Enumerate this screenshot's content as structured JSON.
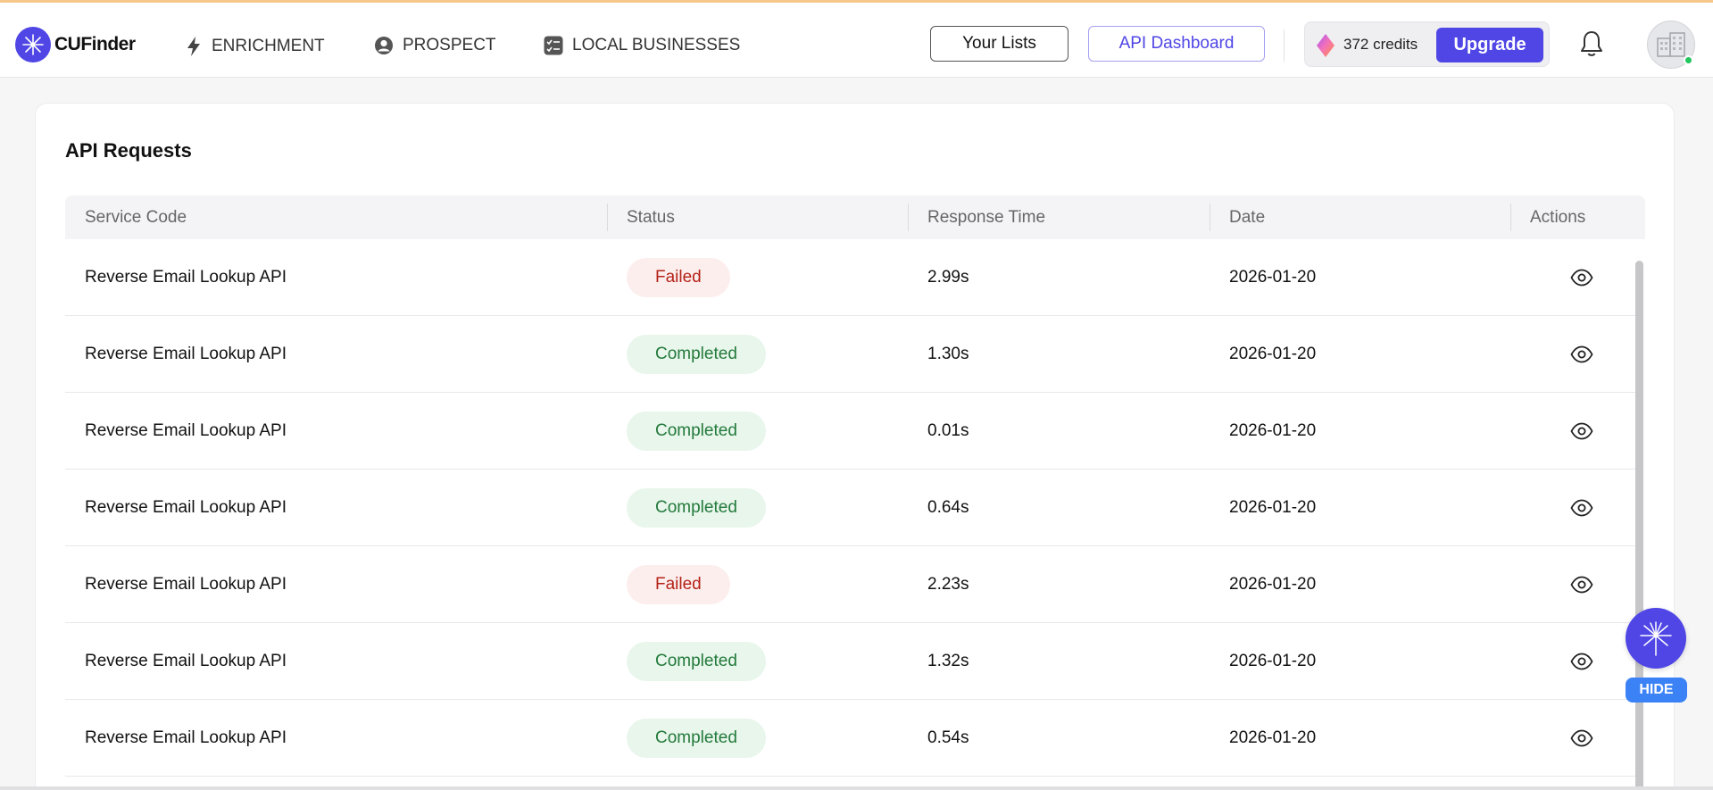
{
  "brand": {
    "name": "CUFinder",
    "accent": "#4f46e5"
  },
  "nav": [
    {
      "label": "ENRICHMENT",
      "icon": "bolt-icon"
    },
    {
      "label": "PROSPECT",
      "icon": "user-circle-icon"
    },
    {
      "label": "LOCAL BUSINESSES",
      "icon": "checklist-icon"
    }
  ],
  "header": {
    "your_lists": "Your Lists",
    "api_dashboard": "API Dashboard",
    "credits": "372 credits",
    "upgrade": "Upgrade"
  },
  "page": {
    "title": "API Requests",
    "columns": [
      "Service Code",
      "Status",
      "Response Time",
      "Date",
      "Actions"
    ],
    "rows": [
      {
        "service": "Reverse Email Lookup API",
        "status": "Failed",
        "response_time": "2.99s",
        "date": "2026-01-20"
      },
      {
        "service": "Reverse Email Lookup API",
        "status": "Completed",
        "response_time": "1.30s",
        "date": "2026-01-20"
      },
      {
        "service": "Reverse Email Lookup API",
        "status": "Completed",
        "response_time": "0.01s",
        "date": "2026-01-20"
      },
      {
        "service": "Reverse Email Lookup API",
        "status": "Completed",
        "response_time": "0.64s",
        "date": "2026-01-20"
      },
      {
        "service": "Reverse Email Lookup API",
        "status": "Failed",
        "response_time": "2.23s",
        "date": "2026-01-20"
      },
      {
        "service": "Reverse Email Lookup API",
        "status": "Completed",
        "response_time": "1.32s",
        "date": "2026-01-20"
      },
      {
        "service": "Reverse Email Lookup API",
        "status": "Completed",
        "response_time": "0.54s",
        "date": "2026-01-20"
      }
    ]
  },
  "widget": {
    "hide_label": "HIDE"
  },
  "colors": {
    "failed_bg": "#fdeeee",
    "failed_text": "#b42318",
    "completed_bg": "#e8f6ec",
    "completed_text": "#237a3b"
  }
}
